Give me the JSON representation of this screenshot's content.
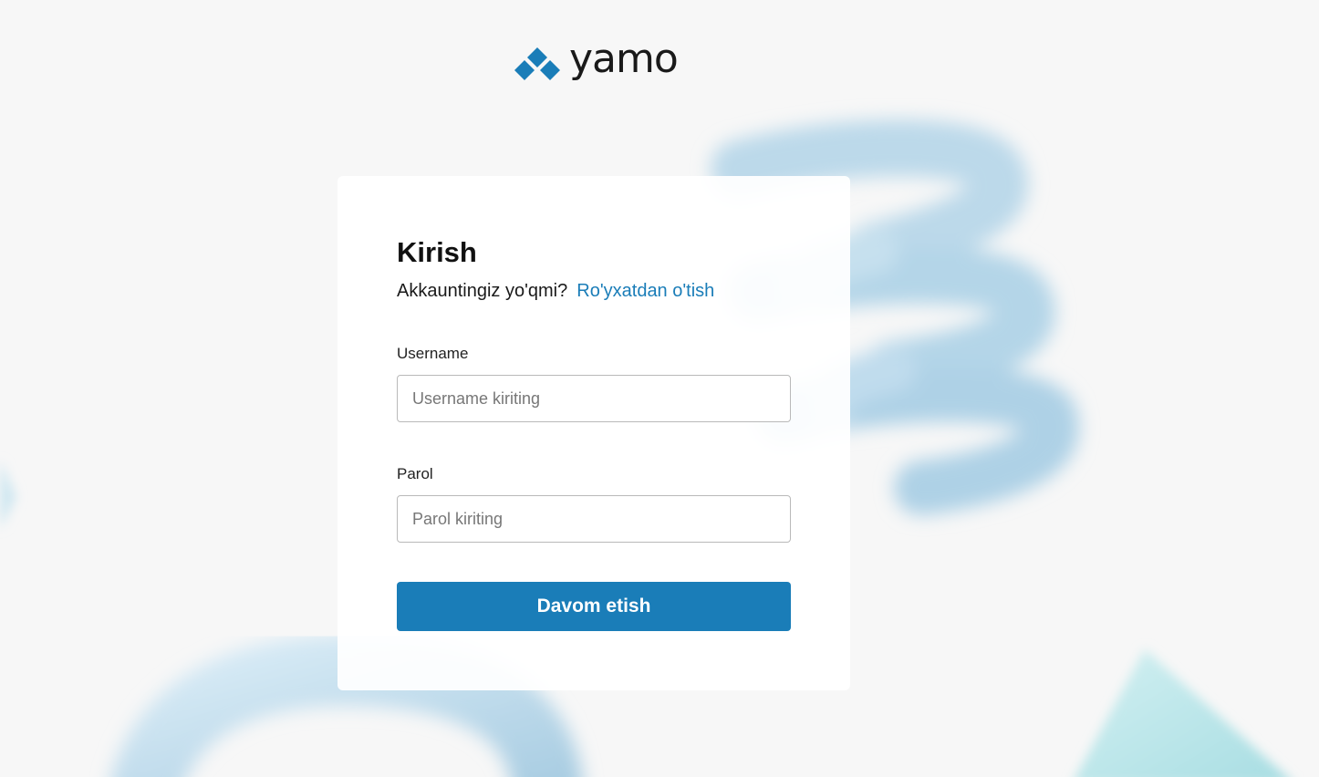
{
  "brand": {
    "name": "yamo",
    "logo_icon": "diamond-cluster-icon",
    "accent_color": "#1a7db8"
  },
  "login": {
    "title": "Kirish",
    "prompt": "Akkauntingiz yo'qmi?",
    "register_link": "Ro'yxatdan o'tish",
    "username": {
      "label": "Username",
      "placeholder": "Username kiriting",
      "value": ""
    },
    "password": {
      "label": "Parol",
      "placeholder": "Parol kiriting",
      "value": ""
    },
    "submit_label": "Davom etish"
  }
}
